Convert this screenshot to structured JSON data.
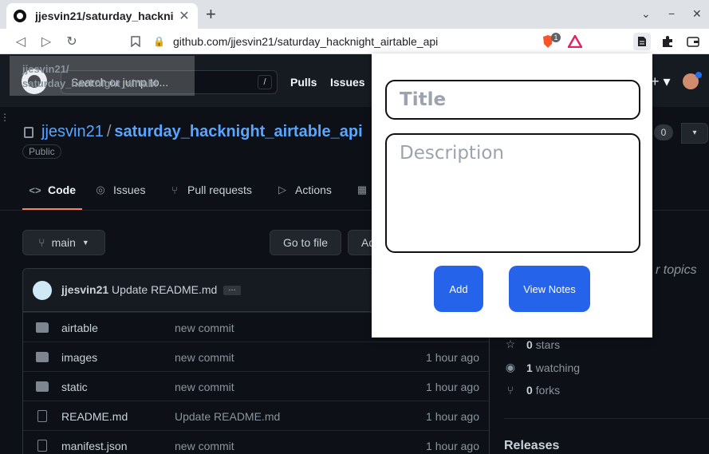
{
  "browser": {
    "tab_title": "jjesvin21/saturday_hackni",
    "url": "github.com/jjesvin21/saturday_hacknight_airtable_api",
    "ext_badge": "1"
  },
  "github": {
    "search_placeholder": "Search or jump to...",
    "search_key": "/",
    "nav_pulls": "Pulls",
    "nav_issues": "Issues",
    "ghost_title_line1": "jjesvin21/",
    "ghost_title_line2": "saturday_hacknight_airtabl",
    "owner": "jjesvin21",
    "separator": "/",
    "repo": "saturday_hacknight_airtable_api",
    "visibility": "Public",
    "counter": "0",
    "tabs": {
      "code": "Code",
      "issues": "Issues",
      "pulls": "Pull requests",
      "actions": "Actions"
    },
    "branch": "main",
    "goto_file": "Go to file",
    "add_file": "Ad",
    "commit_author": "jjesvin21",
    "commit_message": "Update README.md",
    "commit_dots": "…",
    "files": [
      {
        "name": "airtable",
        "type": "folder",
        "message": "new commit",
        "age": ""
      },
      {
        "name": "images",
        "type": "folder",
        "message": "new commit",
        "age": "1 hour ago"
      },
      {
        "name": "static",
        "type": "folder",
        "message": "new commit",
        "age": "1 hour ago"
      },
      {
        "name": "README.md",
        "type": "file",
        "message": "Update README.md",
        "age": "1 hour ago"
      },
      {
        "name": "manifest.json",
        "type": "file",
        "message": "new commit",
        "age": "1 hour ago"
      }
    ],
    "topics_text": "r topics",
    "stars": {
      "count": "0",
      "label": "stars"
    },
    "watching": {
      "count": "1",
      "label": "watching"
    },
    "forks": {
      "count": "0",
      "label": "forks"
    },
    "releases": "Releases"
  },
  "popup": {
    "title_placeholder": "Title",
    "description_placeholder": "Description",
    "add_label": "Add",
    "view_label": "View Notes",
    "button_color": "#2563eb"
  }
}
